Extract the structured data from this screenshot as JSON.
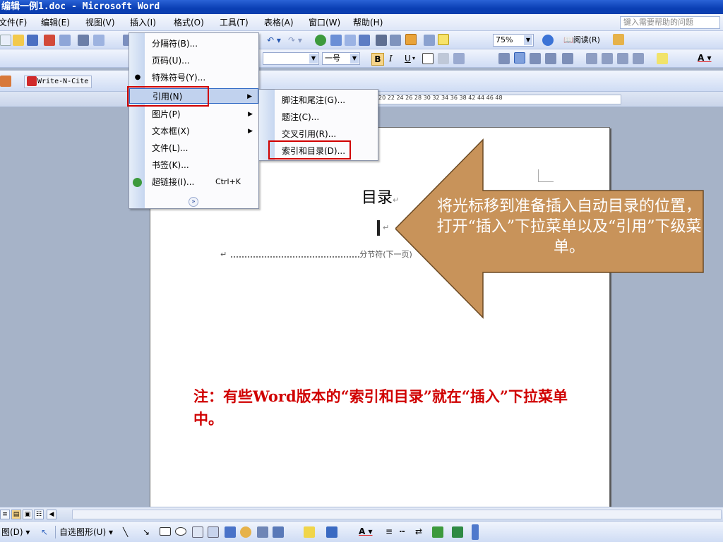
{
  "window": {
    "title": "编辑一例1.doc - Microsoft Word"
  },
  "menubar": {
    "items": [
      "文件(F)",
      "编辑(E)",
      "视图(V)",
      "插入(I)",
      "格式(O)",
      "工具(T)",
      "表格(A)",
      "窗口(W)",
      "帮助(H)"
    ],
    "help_placeholder": "键入需要帮助的问题"
  },
  "toolbar": {
    "zoom": "75%",
    "read_label": "阅读(R)",
    "font_size": "一号",
    "bold": "B",
    "italic": "I",
    "underline": "U",
    "writencite_label": "Write-N-Cite"
  },
  "ruler": {
    "labels": "20  22  24  26  28  30  32  34  36  38      42  44  46  48"
  },
  "insert_menu": {
    "items": [
      {
        "label": "分隔符(B)..."
      },
      {
        "label": "页码(U)..."
      },
      {
        "label": "特殊符号(Y)..."
      },
      {
        "label": "引用(N)"
      },
      {
        "label": "图片(P)"
      },
      {
        "label": "文本框(X)"
      },
      {
        "label": "文件(L)..."
      },
      {
        "label": "书签(K)..."
      },
      {
        "label": "超链接(I)...",
        "shortcut": "Ctrl+K"
      }
    ]
  },
  "reference_submenu": {
    "items": [
      {
        "label": "脚注和尾注(G)..."
      },
      {
        "label": "题注(C)..."
      },
      {
        "label": "交叉引用(R)..."
      },
      {
        "label": "索引和目录(D)..."
      }
    ]
  },
  "document": {
    "heading": "目录",
    "section_break": "分节符(下一页)"
  },
  "callout": {
    "text": "将光标移到准备插入自动目录的位置，打开“插入”下拉菜单以及“引用”下级菜单。",
    "fill_color": "#c8935a"
  },
  "note": {
    "text": "注：有些Word版本的“索引和目录”就在“插入”下拉菜单中。"
  },
  "drawbar": {
    "draw_label": "图(D)",
    "autoshapes_label": "自选图形(U)"
  },
  "colors": {
    "highlight_red": "#d00000",
    "titlebar": "#0a3eb4"
  }
}
